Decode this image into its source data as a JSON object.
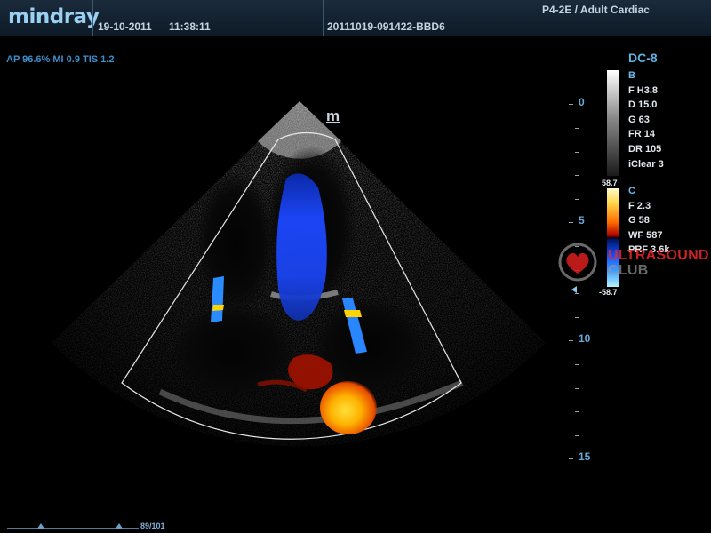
{
  "header": {
    "brand": "mindray",
    "date": "19-10-2011",
    "time": "11:38:11",
    "patient_id": "20111019-091422-BBD6",
    "probe_preset": "P4-2E / Adult Cardiac"
  },
  "safety_indices": "AP 96.6%  MI 0.9  TIS 1.2",
  "probe_marker": "m",
  "mode": {
    "name": "DC-8",
    "b_mode": {
      "title": "B",
      "params": [
        "F H3.8",
        "D 15.0",
        "G 63",
        "FR 14",
        "DR 105",
        "iClear 3"
      ]
    },
    "color_mode": {
      "title": "C",
      "params": [
        "F 2.3",
        "G 58",
        "WF 587",
        "PRF 3.6k"
      ]
    }
  },
  "color_bar": {
    "max": "58.7",
    "min": "-58.7"
  },
  "depth_scale": {
    "labels": [
      {
        "text": "0",
        "depth_cm": 0
      },
      {
        "text": "5",
        "depth_cm": 5
      },
      {
        "text": "10",
        "depth_cm": 10
      },
      {
        "text": "15",
        "depth_cm": 15
      }
    ],
    "max_depth_cm": 15
  },
  "watermark": {
    "line1": "ULTRASOUND",
    "line2": "CLUB"
  },
  "cine": {
    "frame_counter": "89/101",
    "current_frame": 89,
    "total_frames": 101
  },
  "colors": {
    "header_bg": "#12202e",
    "accent": "#6dbbe6",
    "flow_toward": "#ff8a00",
    "flow_away": "#1a4dff"
  }
}
